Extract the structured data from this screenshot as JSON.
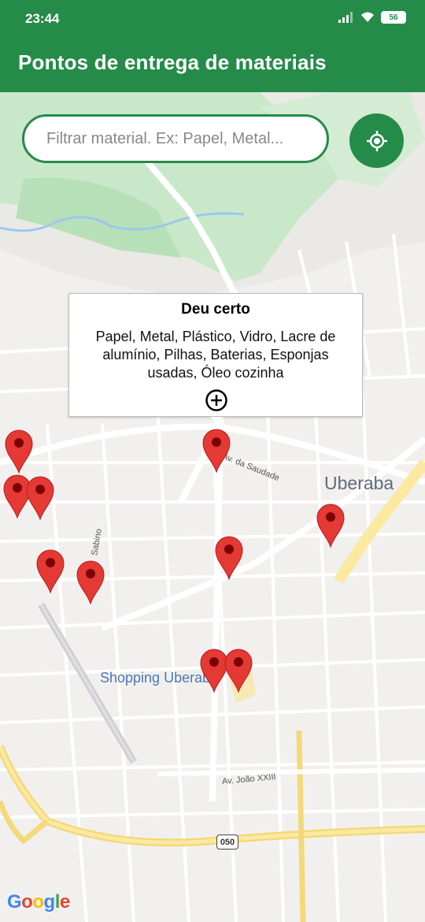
{
  "status": {
    "time": "23:44",
    "battery": "56"
  },
  "appbar": {
    "title": "Pontos de entrega de materiais"
  },
  "search": {
    "placeholder": "Filtrar material. Ex: Papel, Metal..."
  },
  "infowindow": {
    "title": "Deu certo",
    "body": "Papel, Metal, Plástico, Vidro, Lacre de alumínio, Pilhas, Baterias, Esponjas usadas, Óleo cozinha"
  },
  "map": {
    "city": "Uberaba",
    "shopping": "Shopping Uberaba",
    "road1": "Av. da Saudade",
    "road2": "Av. João XXIII",
    "road3": "Sabino",
    "highway": "050",
    "attribution": "Google"
  },
  "colors": {
    "primary": "#258b49",
    "pin": "#e53935"
  },
  "icons": {
    "locate": "my-location-icon",
    "add": "add-circle-icon",
    "marker": "map-marker-icon"
  }
}
